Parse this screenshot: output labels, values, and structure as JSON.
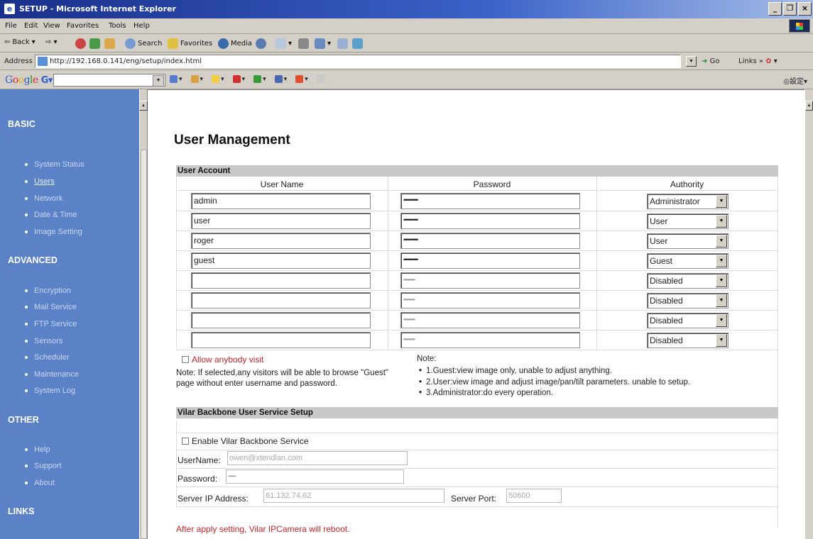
{
  "window": {
    "title": "SETUP - Microsoft Internet Explorer"
  },
  "menubar": {
    "items": [
      "File",
      "Edit",
      "View",
      "Favorites",
      "Tools",
      "Help"
    ]
  },
  "toolbar": {
    "back": "Back",
    "search": "Search",
    "favorites": "Favorites",
    "media": "Media"
  },
  "address": {
    "label": "Address",
    "url": "http://192.168.0.141/eng/setup/index.html",
    "go": "Go",
    "links": "Links"
  },
  "google": {
    "logo": "Google",
    "settings": "設定"
  },
  "sidebar": {
    "basic_title": "BASIC",
    "basic_items": [
      "System Status",
      "Users",
      "Network",
      "Date & Time",
      "Image Setting"
    ],
    "advanced_title": "ADVANCED",
    "advanced_items": [
      "Encryption",
      "Mail Service",
      "FTP Service",
      "Sensors",
      "Scheduler",
      "Maintenance",
      "System Log"
    ],
    "other_title": "OTHER",
    "other_items": [
      "Help",
      "Support",
      "About"
    ],
    "links_title": "LINKS"
  },
  "page": {
    "title": "User Management",
    "user_account_header": "User Account",
    "col_user": "User Name",
    "col_password": "Password",
    "col_authority": "Authority",
    "rows": [
      {
        "user": "admin",
        "password": "••••••••••••",
        "authority": "Administrator"
      },
      {
        "user": "user",
        "password": "••••••••••••",
        "authority": "User"
      },
      {
        "user": "roger",
        "password": "••••••••••••",
        "authority": "User"
      },
      {
        "user": "guest",
        "password": "••••••••••••",
        "authority": "Guest"
      },
      {
        "user": "",
        "password": "••••••••••••",
        "authority": "Disabled"
      },
      {
        "user": "",
        "password": "••••••••••••",
        "authority": "Disabled"
      },
      {
        "user": "",
        "password": "••••••••••••",
        "authority": "Disabled"
      },
      {
        "user": "",
        "password": "••••••••••••",
        "authority": "Disabled"
      }
    ],
    "allow_label": "Allow anybody visit",
    "allow_note": "Note: If selected,any visitors will be able to browse \"Guest\" page without enter username and password.",
    "note_title": "Note:",
    "notes": [
      "1.Guest:view image only, unable to adjust anything.",
      "2.User:view image and adjust image/pan/tilt parameters. unable to setup.",
      "3.Administrator:do every operation."
    ],
    "vilar_header": "Vilar Backbone User Service Setup",
    "enable_label": "Enable Vilar Backbone Service",
    "username_label": "UserName:",
    "username_value": "owen@xtendlan.com",
    "password_label": "Password:",
    "password_value": "••••••",
    "server_ip_label": "Server IP Address:",
    "server_ip_value": "61.132.74.62",
    "server_port_label": "Server Port:",
    "server_port_value": "50600",
    "reboot_note": "After apply setting, Vilar IPCamera will reboot."
  }
}
